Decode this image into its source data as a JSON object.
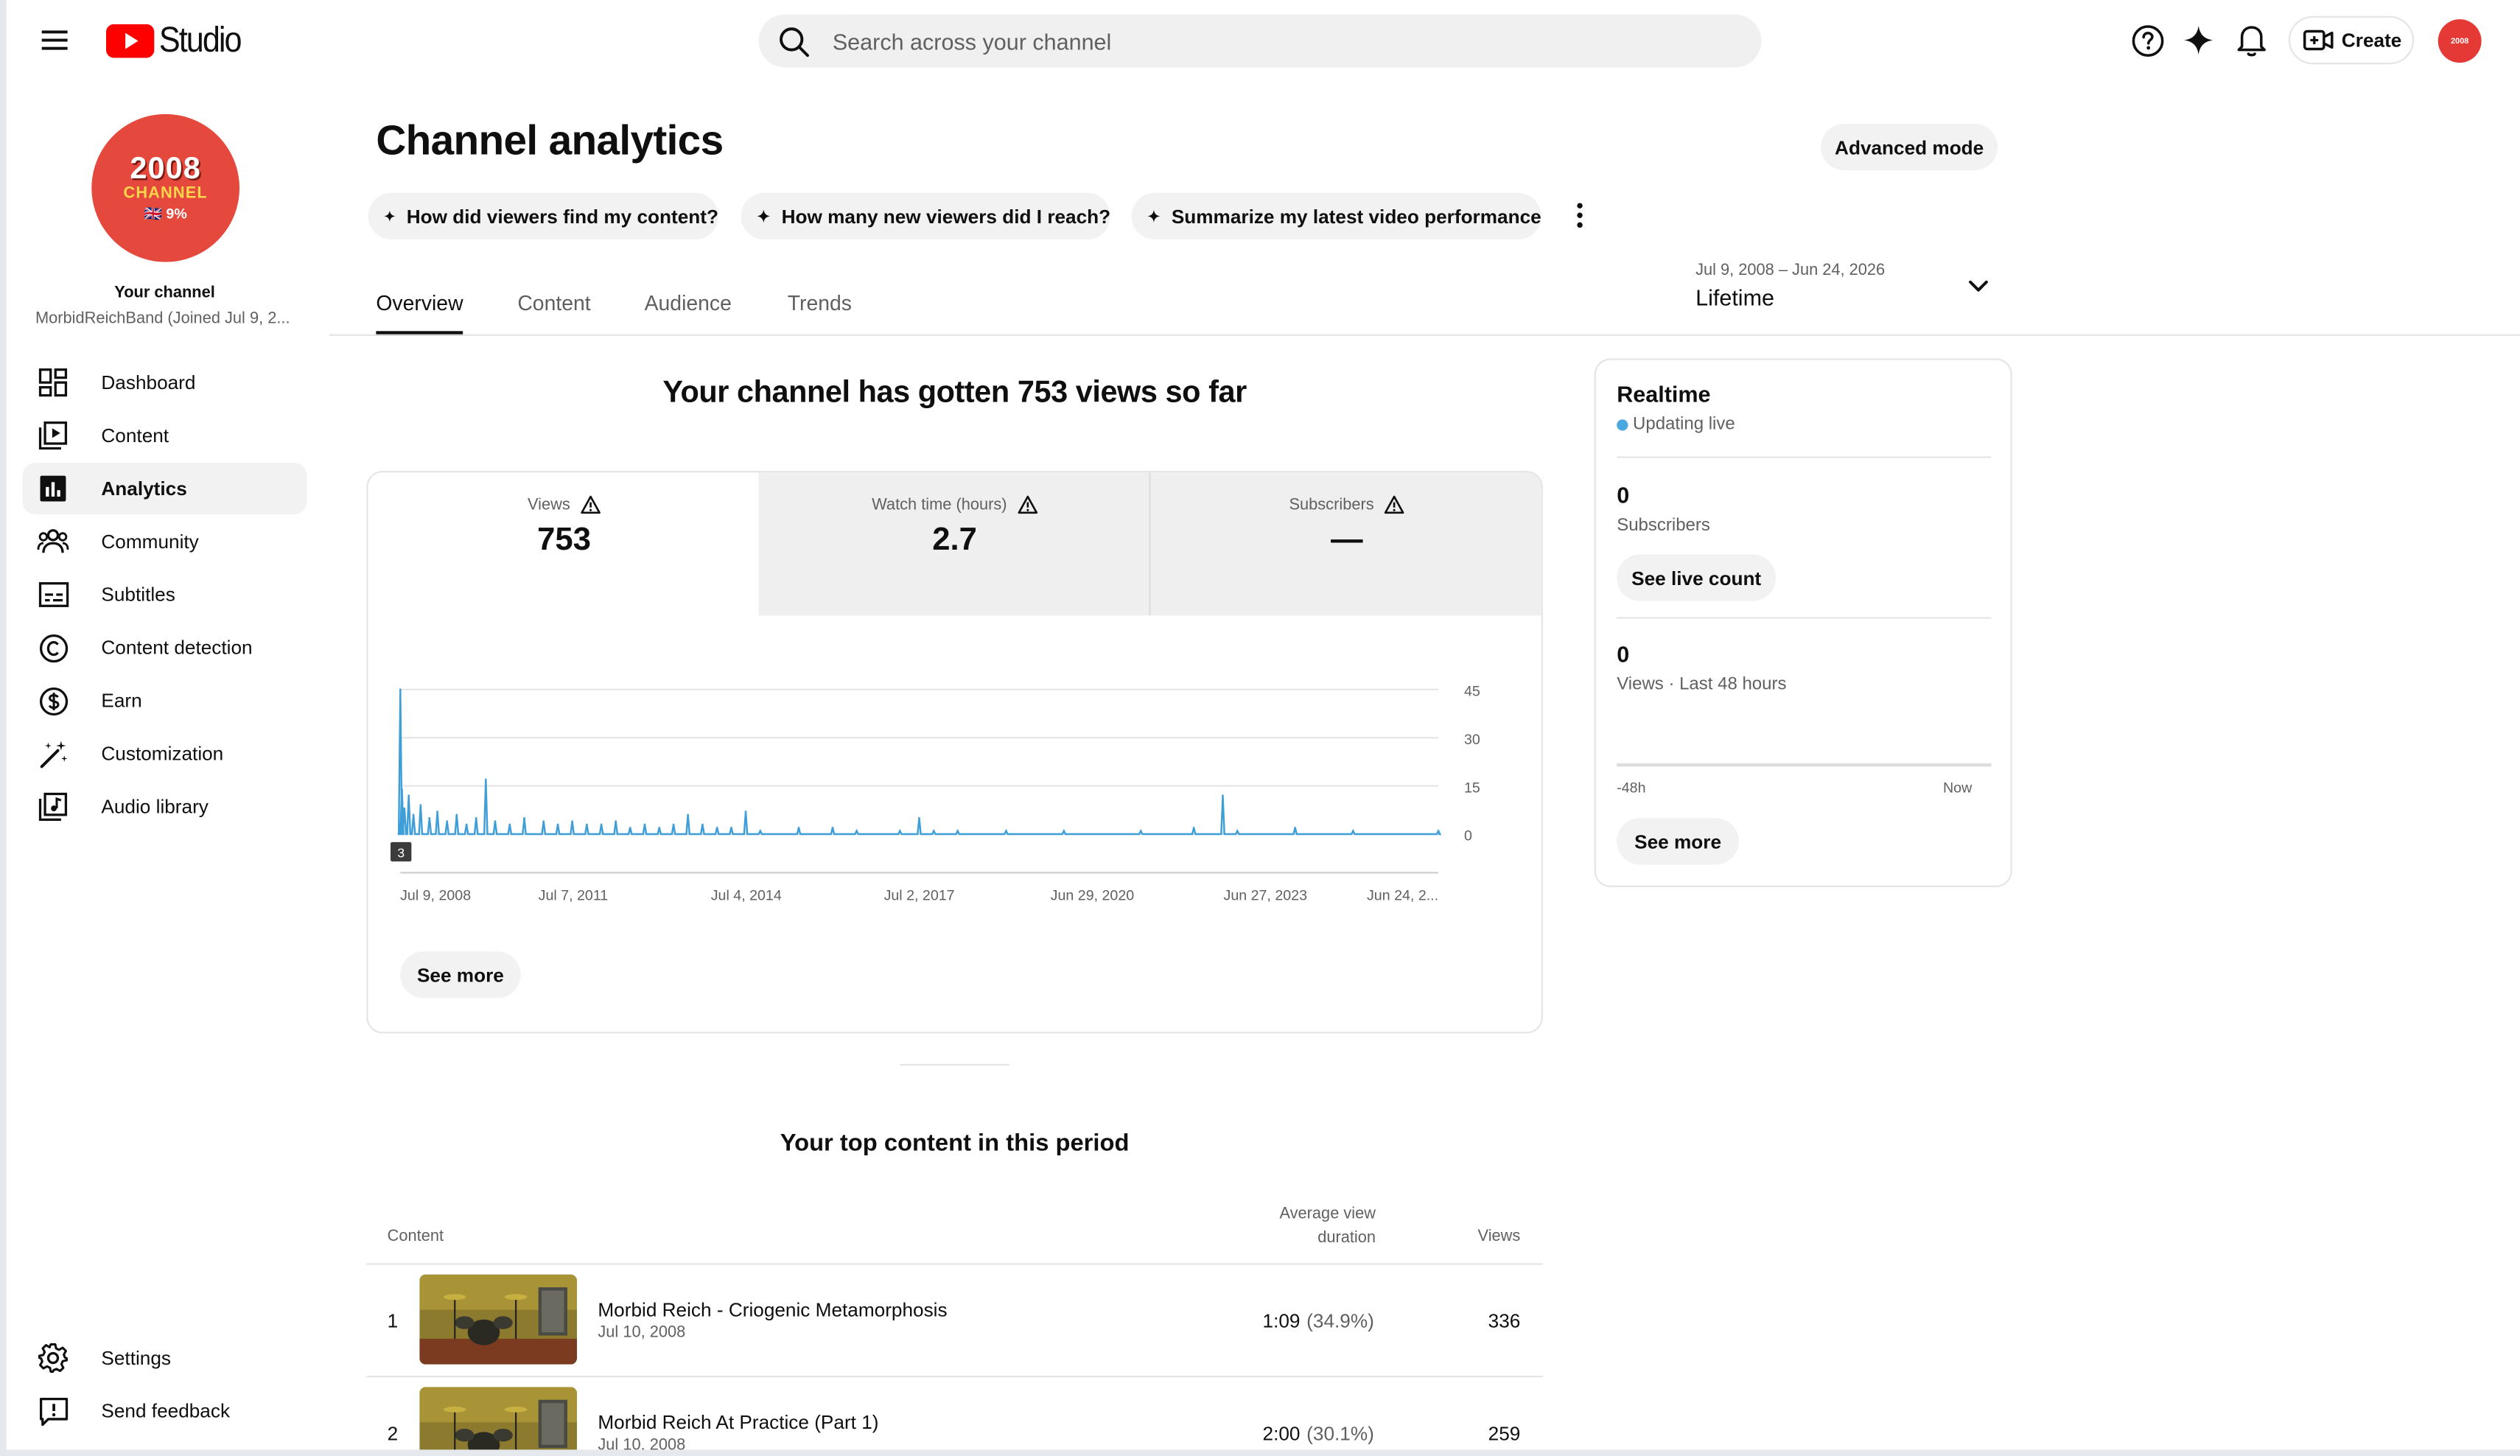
{
  "header": {
    "app_name": "Studio",
    "search_placeholder": "Search across your channel",
    "create_label": "Create",
    "avatar_text": "2008"
  },
  "sidebar": {
    "avatar": {
      "line1": "2008",
      "line2": "CHANNEL",
      "line3": "🇬🇧 9%"
    },
    "your_channel": "Your channel",
    "channel_name": "MorbidReichBand (Joined Jul 9, 2...",
    "items": [
      {
        "label": "Dashboard",
        "icon": "dashboard-icon"
      },
      {
        "label": "Content",
        "icon": "content-icon"
      },
      {
        "label": "Analytics",
        "icon": "analytics-icon",
        "active": true
      },
      {
        "label": "Community",
        "icon": "community-icon"
      },
      {
        "label": "Subtitles",
        "icon": "subtitles-icon"
      },
      {
        "label": "Content detection",
        "icon": "copyright-icon"
      },
      {
        "label": "Earn",
        "icon": "dollar-icon"
      },
      {
        "label": "Customization",
        "icon": "magic-wand-icon"
      },
      {
        "label": "Audio library",
        "icon": "audio-library-icon"
      }
    ],
    "bottom_items": [
      {
        "label": "Settings",
        "icon": "gear-icon"
      },
      {
        "label": "Send feedback",
        "icon": "feedback-icon"
      }
    ]
  },
  "main": {
    "title": "Channel analytics",
    "advanced_mode": "Advanced mode",
    "chips": [
      "How did viewers find my content?",
      "How many new viewers did I reach?",
      "Summarize my latest video performance"
    ],
    "tabs": [
      "Overview",
      "Content",
      "Audience",
      "Trends"
    ],
    "active_tab": "Overview",
    "date_range": {
      "range": "Jul 9, 2008 – Jun 24, 2026",
      "label": "Lifetime"
    },
    "summary_heading": "Your channel has gotten 753 views so far",
    "metrics": [
      {
        "label": "Views",
        "value": "753",
        "warning": true,
        "selected": true
      },
      {
        "label": "Watch time (hours)",
        "value": "2.7",
        "warning": true,
        "selected": false
      },
      {
        "label": "Subscribers",
        "value": "—",
        "warning": true,
        "selected": false
      }
    ],
    "chart_marker": "3",
    "see_more": "See more",
    "top_content_heading": "Your top content in this period",
    "table_headers": {
      "content": "Content",
      "avd_line1": "Average view",
      "avd_line2": "duration",
      "views": "Views"
    },
    "rows": [
      {
        "rank": "1",
        "title": "Morbid Reich - Criogenic Metamorphosis",
        "date": "Jul 10, 2008",
        "avd": "1:09",
        "avd_pct": "(34.9%)",
        "views": "336"
      },
      {
        "rank": "2",
        "title": "Morbid Reich At Practice (Part 1)",
        "date": "Jul 10, 2008",
        "avd": "2:00",
        "avd_pct": "(30.1%)",
        "views": "259"
      }
    ]
  },
  "chart_data": {
    "type": "line",
    "title": "",
    "series": [
      {
        "name": "Views"
      }
    ],
    "x_ticks": [
      "Jul 9, 2008",
      "Jul 7, 2011",
      "Jul 4, 2014",
      "Jul 2, 2017",
      "Jun 29, 2020",
      "Jun 27, 2023",
      "Jun 24, 2..."
    ],
    "y_ticks": [
      "45",
      "30",
      "15",
      "0"
    ],
    "ylim": [
      0,
      45
    ],
    "x_range": [
      "Jul 9, 2008",
      "Jun 24, 2026"
    ],
    "points": [
      [
        "2008-07-09",
        3
      ],
      [
        "2008-07-10",
        45
      ],
      [
        "2008-07-20",
        14
      ],
      [
        "2008-08-05",
        8
      ],
      [
        "2008-09-01",
        12
      ],
      [
        "2008-10-01",
        6
      ],
      [
        "2008-11-15",
        9
      ],
      [
        "2009-01-10",
        5
      ],
      [
        "2009-03-01",
        7
      ],
      [
        "2009-05-01",
        4
      ],
      [
        "2009-07-01",
        6
      ],
      [
        "2009-09-01",
        3
      ],
      [
        "2009-11-01",
        5
      ],
      [
        "2010-01-01",
        17
      ],
      [
        "2010-03-01",
        4
      ],
      [
        "2010-06-01",
        3
      ],
      [
        "2010-09-01",
        5
      ],
      [
        "2011-01-01",
        4
      ],
      [
        "2011-04-01",
        3
      ],
      [
        "2011-07-01",
        4
      ],
      [
        "2011-10-01",
        3
      ],
      [
        "2012-01-01",
        3
      ],
      [
        "2012-04-01",
        4
      ],
      [
        "2012-07-01",
        2
      ],
      [
        "2012-10-01",
        3
      ],
      [
        "2013-01-01",
        2
      ],
      [
        "2013-04-01",
        3
      ],
      [
        "2013-07-01",
        6
      ],
      [
        "2013-10-01",
        3
      ],
      [
        "2014-01-01",
        2
      ],
      [
        "2014-04-01",
        2
      ],
      [
        "2014-07-01",
        7
      ],
      [
        "2014-10-01",
        1
      ],
      [
        "2015-06-01",
        2
      ],
      [
        "2016-01-01",
        2
      ],
      [
        "2016-06-01",
        1
      ],
      [
        "2017-03-01",
        1
      ],
      [
        "2017-07-01",
        5
      ],
      [
        "2017-10-01",
        1
      ],
      [
        "2018-03-01",
        1
      ],
      [
        "2019-01-01",
        1
      ],
      [
        "2020-01-01",
        1
      ],
      [
        "2021-05-01",
        1
      ],
      [
        "2022-04-01",
        2
      ],
      [
        "2022-10-01",
        12
      ],
      [
        "2023-01-01",
        1
      ],
      [
        "2024-01-01",
        2
      ],
      [
        "2025-01-01",
        1
      ],
      [
        "2026-06-24",
        1
      ]
    ]
  },
  "realtime": {
    "title": "Realtime",
    "live_label": "Updating live",
    "subscribers_value": "0",
    "subscribers_label": "Subscribers",
    "see_live_count": "See live count",
    "views_value": "0",
    "views_label": "Views · Last 48 hours",
    "axis_left": "-48h",
    "axis_right": "Now",
    "see_more": "See more"
  },
  "colors": {
    "youtube_red": "#ff0000",
    "chart_line": "#3f9ed8",
    "live_dot": "#4aa8e0",
    "chip_bg": "#f2f2f2"
  }
}
